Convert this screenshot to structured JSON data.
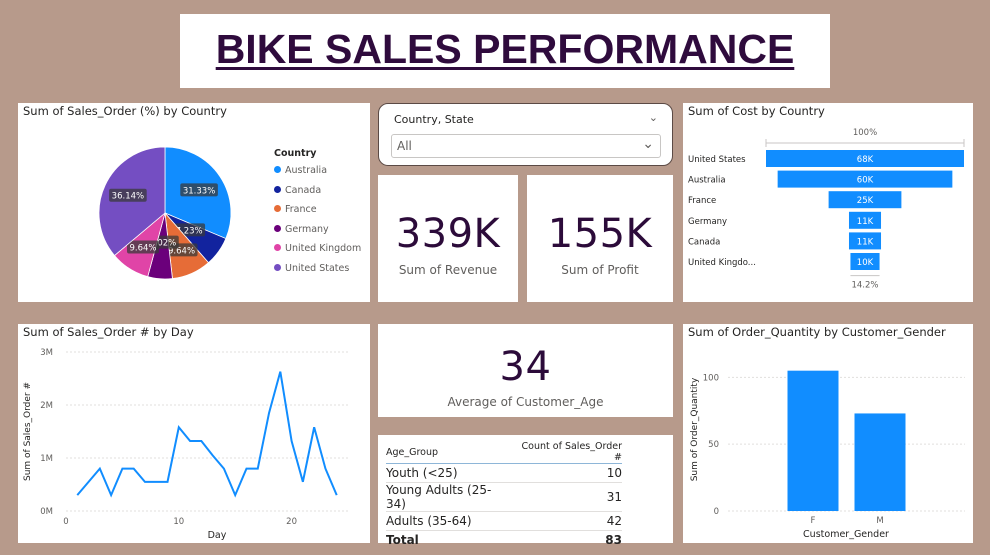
{
  "title": "BIKE SALES PERFORMANCE",
  "pie": {
    "title": "Sum of Sales_Order (%) by Country",
    "legend_title": "Country"
  },
  "slicer": {
    "label": "Country, State",
    "value": "All"
  },
  "revenue": {
    "value": "339K",
    "label": "Sum of Revenue"
  },
  "profit": {
    "value": "155K",
    "label": "Sum of  Profit"
  },
  "funnel": {
    "title": "Sum of Cost by Country",
    "top_pct": "100%",
    "bottom_pct": "14.2%"
  },
  "line": {
    "title": "Sum of Sales_Order # by Day"
  },
  "age": {
    "value": "34",
    "label": "Average of Customer_Age"
  },
  "age_table": {
    "headers": [
      "Age_Group",
      "Count of Sales_Order #"
    ],
    "rows": [
      {
        "group": "Youth (<25)",
        "count": "10"
      },
      {
        "group": "Young Adults (25-34)",
        "count": "31"
      },
      {
        "group": "Adults (35-64)",
        "count": "42"
      }
    ],
    "total_label": "Total",
    "total_value": "83"
  },
  "bar": {
    "title": "Sum of Order_Quantity by Customer_Gender"
  },
  "chart_data": [
    {
      "type": "pie",
      "title": "Sum of Sales_Order (%) by Country",
      "legend_title": "Country",
      "categories": [
        "Australia",
        "Canada",
        "France",
        "Germany",
        "United Kingdom",
        "United States"
      ],
      "values": [
        31.33,
        7.23,
        9.64,
        6.02,
        9.64,
        36.14
      ],
      "labels": [
        "31.33%",
        "7.23%",
        "9.64%",
        "6.02%",
        "9.64%",
        "36.14%"
      ],
      "colors": [
        "#118dff",
        "#12239e",
        "#e66c37",
        "#6b007b",
        "#e044a7",
        "#744ec2"
      ]
    },
    {
      "type": "bar",
      "title": "Sum of Cost by Country",
      "categories": [
        "United States",
        "Australia",
        "France",
        "Germany",
        "Canada",
        "United Kingdo..."
      ],
      "values": [
        68,
        60,
        25,
        11,
        11,
        10
      ],
      "labels": [
        "68K",
        "60K",
        "25K",
        "11K",
        "11K",
        "10K"
      ],
      "color": "#118dff"
    },
    {
      "type": "line",
      "title": "Sum of Sales_Order # by Day",
      "xlabel": "Day",
      "ylabel": "Sum of Sales_Order #",
      "x": [
        1,
        2,
        3,
        4,
        5,
        6,
        7,
        8,
        9,
        10,
        11,
        12,
        13,
        14,
        15,
        16,
        17,
        18,
        19,
        20,
        21,
        22,
        23,
        24
      ],
      "y": [
        0.3,
        0.55,
        0.8,
        0.3,
        0.8,
        0.8,
        0.55,
        0.55,
        0.55,
        1.58,
        1.32,
        1.32,
        1.05,
        0.8,
        0.3,
        0.8,
        0.8,
        1.85,
        2.63,
        1.32,
        0.55,
        1.58,
        0.8,
        0.3
      ],
      "xticks": [
        "0",
        "10",
        "20"
      ],
      "yticks": [
        "0M",
        "1M",
        "2M",
        "3M"
      ],
      "ylim": [
        0,
        3
      ],
      "color": "#118dff"
    },
    {
      "type": "bar",
      "title": "Sum of Order_Quantity by Customer_Gender",
      "xlabel": "Customer_Gender",
      "ylabel": "Sum of Order_Quantity",
      "categories": [
        "F",
        "M"
      ],
      "values": [
        105,
        73
      ],
      "yticks": [
        "0",
        "50",
        "100"
      ],
      "ylim": [
        0,
        110
      ],
      "color": "#118dff"
    }
  ]
}
